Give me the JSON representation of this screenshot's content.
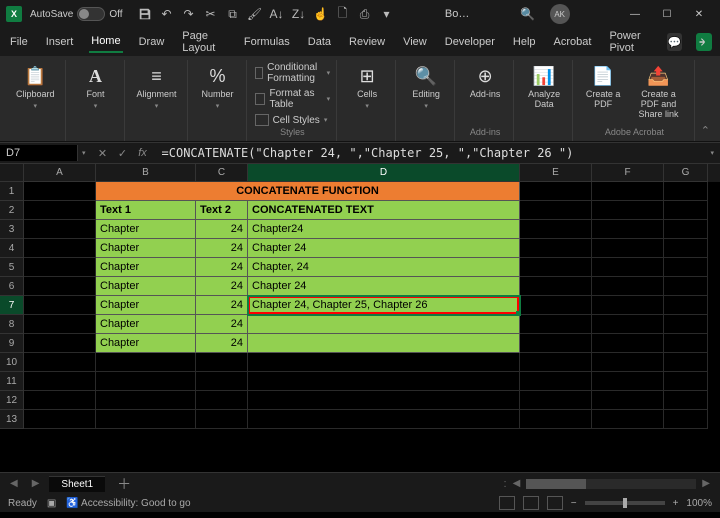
{
  "titlebar": {
    "autosave_label": "AutoSave",
    "autosave_state": "Off",
    "doc_title": "Bo…",
    "avatar": "AK"
  },
  "tabs": [
    "File",
    "Insert",
    "Home",
    "Draw",
    "Page Layout",
    "Formulas",
    "Data",
    "Review",
    "View",
    "Developer",
    "Help",
    "Acrobat",
    "Power Pivot"
  ],
  "active_tab": "Home",
  "ribbon": {
    "clipboard": {
      "label": "Clipboard",
      "paste": "Clipboard"
    },
    "font": {
      "label": "Font",
      "btn": "Font"
    },
    "alignment": {
      "label": "Alignment",
      "btn": "Alignment"
    },
    "number": {
      "label": "Number",
      "btn": "Number"
    },
    "styles": {
      "label": "Styles",
      "cond_fmt": "Conditional Formatting",
      "table": "Format as Table",
      "cell_styles": "Cell Styles"
    },
    "cells": {
      "label": "Cells",
      "btn": "Cells"
    },
    "editing": {
      "label": "Editing",
      "btn": "Editing"
    },
    "addins": {
      "label": "Add-ins",
      "btn": "Add-ins"
    },
    "analyze": {
      "label": "Analyze Data",
      "btn": "Analyze Data"
    },
    "acrobat": {
      "label": "Adobe Acrobat",
      "create": "Create a PDF",
      "share": "Create a PDF and Share link"
    }
  },
  "formula_bar": {
    "name_box": "D7",
    "formula": "=CONCATENATE(\"Chapter 24, \",\"Chapter 25, \",\"Chapter 26 \")"
  },
  "columns": [
    "A",
    "B",
    "C",
    "D",
    "E",
    "F",
    "G"
  ],
  "sheet": {
    "title": "CONCATENATE FUNCTION",
    "headers": {
      "b": "Text 1",
      "c": "Text 2",
      "d": "CONCATENATED TEXT"
    },
    "rows": [
      {
        "b": "Chapter",
        "c": "24",
        "d": "Chapter24"
      },
      {
        "b": "Chapter",
        "c": "24",
        "d": "Chapter 24"
      },
      {
        "b": "Chapter",
        "c": "24",
        "d": "Chapter, 24"
      },
      {
        "b": "Chapter",
        "c": "24",
        "d": "Chapter 24"
      },
      {
        "b": "Chapter",
        "c": "24",
        "d": "Chapter 24, Chapter 25, Chapter 26"
      },
      {
        "b": "Chapter",
        "c": "24",
        "d": ""
      },
      {
        "b": "Chapter",
        "c": "24",
        "d": ""
      }
    ]
  },
  "sheet_tab": "Sheet1",
  "status": {
    "ready": "Ready",
    "accessibility": "Accessibility: Good to go",
    "zoom": "100%"
  }
}
